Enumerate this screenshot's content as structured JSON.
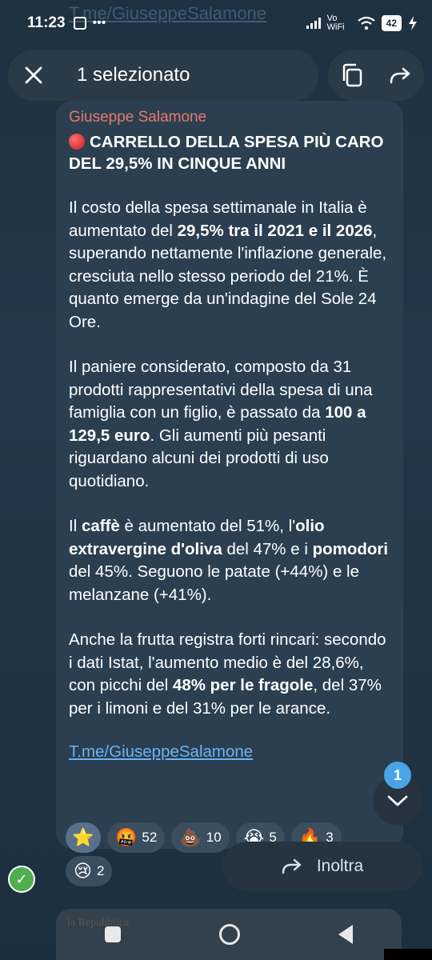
{
  "status_bar": {
    "time": "11:23",
    "network": "Vo WiFi",
    "battery": "42"
  },
  "background_link": "T.me/GiuseppeSalamone",
  "selection_bar": {
    "title": "1 selezionato"
  },
  "message": {
    "sender": "Giuseppe Salamone",
    "title": "CARRELLO DELLA SPESA PIÙ CARO DEL 29,5% IN CINQUE ANNI",
    "p1": {
      "a": "Il costo della spesa settimanale in Italia è aumentato del ",
      "b": "29,5% tra il 2021 e il 2026",
      "c": ", superando nettamente l'inflazione generale, cresciuta nello stesso periodo del 21%. È quanto emerge da un'indagine del Sole 24 Ore."
    },
    "p2": {
      "a": "Il paniere considerato, composto da 31 prodotti rappresentativi della spesa di una famiglia con un figlio, è passato da ",
      "b": "100 a 129,5 euro",
      "c": ". Gli aumenti più pesanti riguardano alcuni dei prodotti di uso quotidiano."
    },
    "p3": {
      "a": "Il ",
      "b": "caffè",
      "c": " è aumentato del 51%, l'",
      "d": "olio extravergine d'oliva",
      "e": " del 47% e i ",
      "f": "pomodori",
      "g": " del 45%. Seguono le patate (+44%) e le melanzane (+41%)."
    },
    "p4": {
      "a": "Anche la frutta registra forti rincari: secondo i dati Istat, l'aumento medio è del 28,6%, con picchi del ",
      "b": "48% per le fragole",
      "c": ", del 37% per i limoni e del 31% per le arance."
    },
    "link": "T.me/GiuseppeSalamone"
  },
  "reactions": [
    {
      "emoji": "⭐",
      "count": ""
    },
    {
      "emoji": "🤬",
      "count": "52"
    },
    {
      "emoji": "💩",
      "count": "10"
    },
    {
      "emoji": "😭",
      "count": "5"
    },
    {
      "emoji": "🔥",
      "count": "3"
    },
    {
      "emoji": "😢",
      "count": "2"
    }
  ],
  "scroll_badge": "1",
  "forward_label": "Inoltra",
  "nav_bg_text": "la Repubblica",
  "icons": [
    "close-icon",
    "copy-icon",
    "share-icon",
    "chevron-down-icon",
    "forward-icon",
    "check-icon"
  ]
}
